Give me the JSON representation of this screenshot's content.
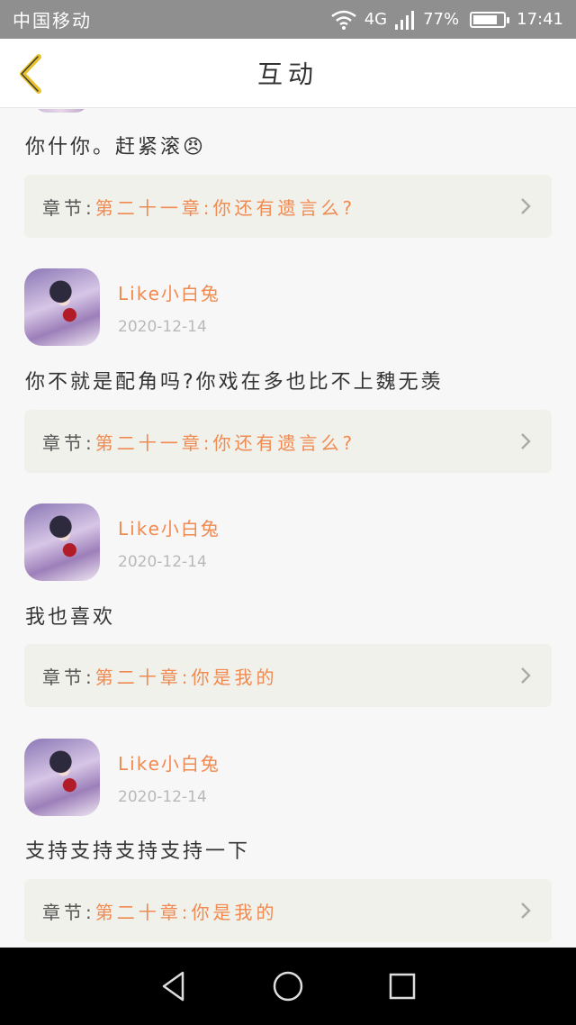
{
  "status_bar": {
    "carrier": "中国移动",
    "network": "4G",
    "battery_percent": "77%",
    "time": "17:41",
    "battery_level": 0.77
  },
  "header": {
    "title": "互动"
  },
  "comments": [
    {
      "text": "你什你。赶紧滚😠",
      "chapter_prefix": "章节:",
      "chapter_title": "第二十一章:你还有遗言么?"
    },
    {
      "user": "Like小白兔",
      "date": "2020-12-14",
      "text": "你不就是配角吗?你戏在多也比不上魏无羡",
      "chapter_prefix": "章节:",
      "chapter_title": "第二十一章:你还有遗言么?"
    },
    {
      "user": "Like小白兔",
      "date": "2020-12-14",
      "text": "我也喜欢",
      "chapter_prefix": "章节:",
      "chapter_title": "第二十章:你是我的"
    },
    {
      "user": "Like小白兔",
      "date": "2020-12-14",
      "text": "支持支持支持支持一下",
      "chapter_prefix": "章节:",
      "chapter_title": "第二十章:你是我的"
    }
  ],
  "colors": {
    "accent": "#f08a50",
    "card_bg": "#f1f1ec",
    "back_icon": "#e8c22a"
  },
  "icons": {
    "back": "chevron-left-icon",
    "chapter_arrow": "chevron-right-icon",
    "nav_back": "triangle-back-icon",
    "nav_home": "circle-home-icon",
    "nav_recent": "square-recent-icon"
  }
}
